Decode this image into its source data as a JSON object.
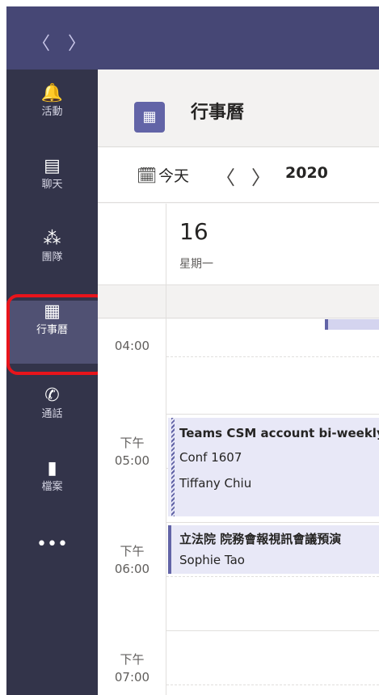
{
  "topbar": {
    "back": "〈",
    "forward": "〉"
  },
  "rail": {
    "items": [
      {
        "label": "活動",
        "icon": "🔔"
      },
      {
        "label": "聊天",
        "icon": "▤"
      },
      {
        "label": "團隊",
        "icon": "⁂"
      },
      {
        "label": "行事曆",
        "icon": "▦"
      },
      {
        "label": "通話",
        "icon": "✆"
      },
      {
        "label": "檔案",
        "icon": "▮"
      },
      {
        "label": "",
        "icon": "•••"
      }
    ]
  },
  "header": {
    "title": "行事曆",
    "icon": "▦"
  },
  "toolbar": {
    "today_label": "今天",
    "prev": "〈",
    "next": "〉",
    "year": "2020"
  },
  "day": {
    "number": "16",
    "weekday": "星期一"
  },
  "times": [
    {
      "period": "",
      "time": "04:00"
    },
    {
      "period": "下午",
      "time": "05:00"
    },
    {
      "period": "下午",
      "time": "06:00"
    },
    {
      "period": "下午",
      "time": "07:00"
    }
  ],
  "events": [
    {
      "title": "Teams CSM account bi-weekly",
      "location": "Conf 1607",
      "organizer": "Tiffany Chiu"
    },
    {
      "title": "立法院 院務會報視訊會議預演",
      "organizer": "Sophie Tao"
    }
  ]
}
